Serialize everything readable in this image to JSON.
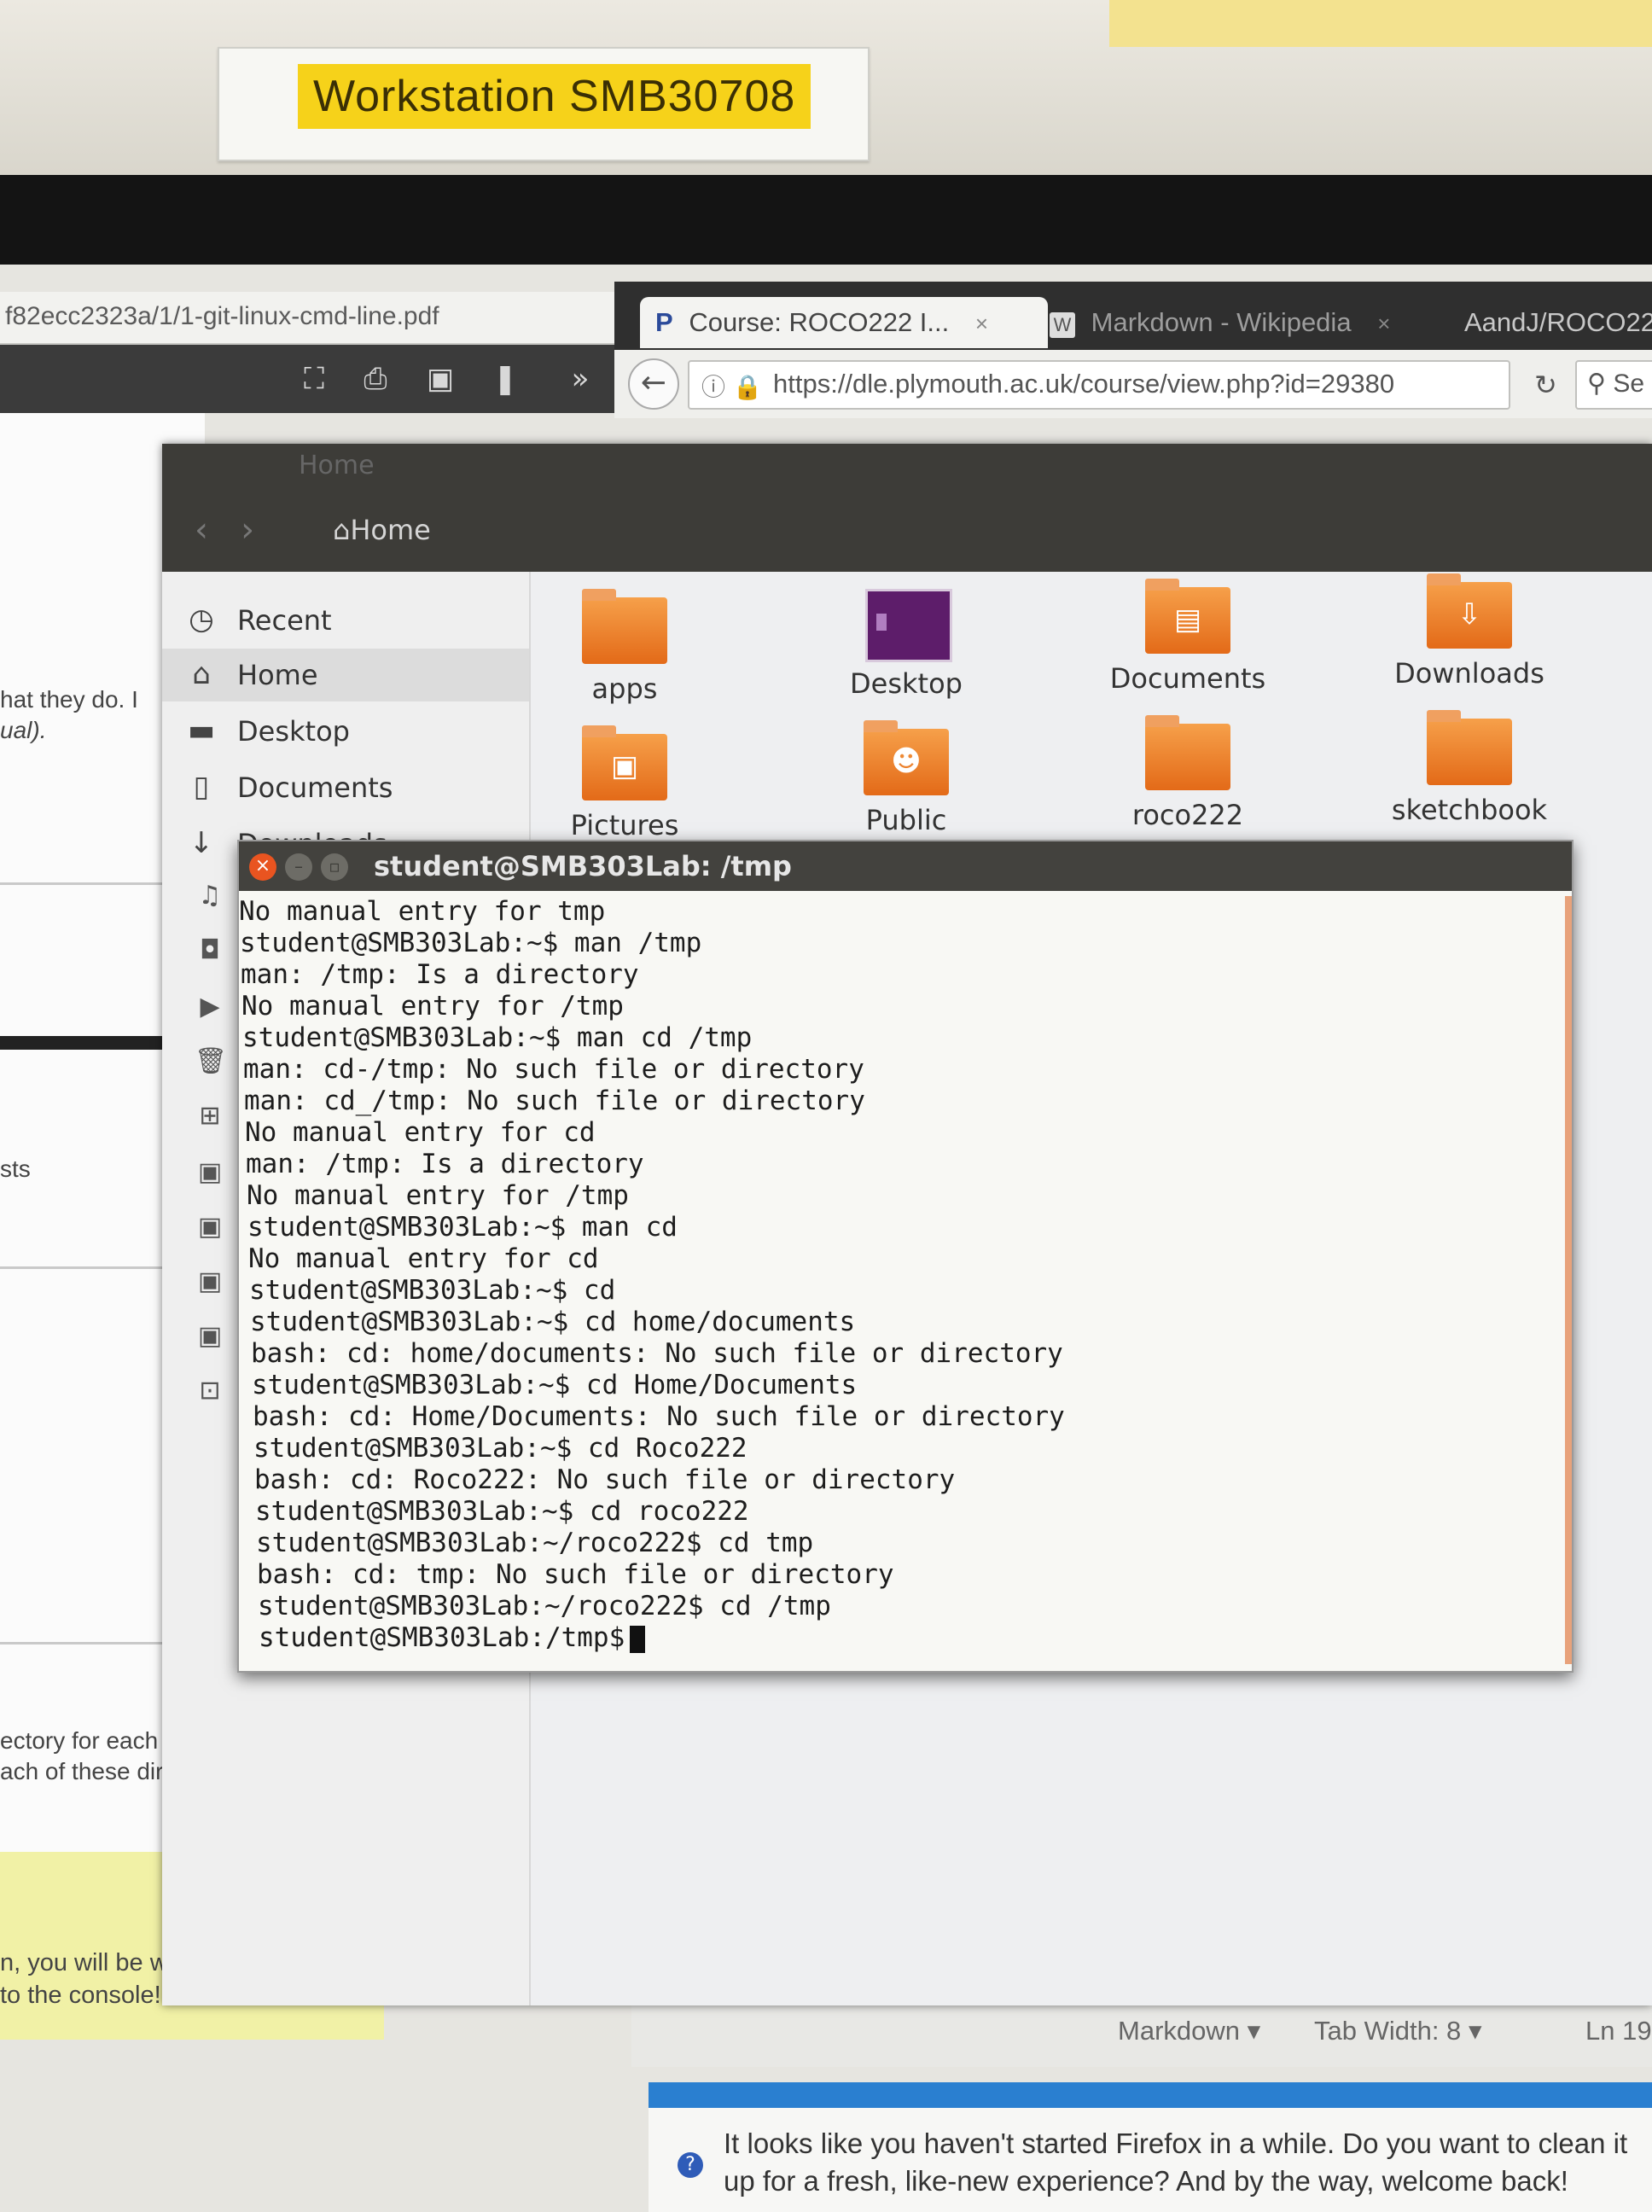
{
  "label": {
    "text": "Workstation  SMB30708"
  },
  "pdf": {
    "url": "f82ecc2323a/1/1-git-linux-cmd-line.pdf",
    "text_1": "hat they do. I",
    "text_2": "ual).",
    "text_3": "sts",
    "text_4": "ectory for each o",
    "text_5": "ach of these direc",
    "note_1": "n, you will be work",
    "note_2": " to the console!"
  },
  "firefox": {
    "tabs": [
      {
        "label": "Course: ROCO222 I...",
        "close": "×",
        "favicon": "P"
      },
      {
        "label": "Markdown - Wikipedia",
        "close": "×",
        "favicon": "W"
      },
      {
        "label": "AandJ/ROCO22"
      }
    ],
    "url": "https://dle.plymouth.ac.uk/course/view.php?id=29380",
    "search_placeholder": "Se",
    "notification": "It looks like you haven't started Firefox in a while. Do you want to clean it up for a fresh, like-new experience? And by the way, welcome back!"
  },
  "editor_status": {
    "language": "Markdown",
    "tab_width": "Tab Width: 8",
    "line": "Ln 19"
  },
  "file_manager": {
    "title": "Home",
    "breadcrumb": "Home",
    "sidebar": [
      {
        "label": "Recent",
        "icon": "clock-icon"
      },
      {
        "label": "Home",
        "icon": "home-icon"
      },
      {
        "label": "Desktop",
        "icon": "folder-icon"
      },
      {
        "label": "Documents",
        "icon": "document-icon"
      },
      {
        "label": "Downloads",
        "icon": "download-icon"
      }
    ],
    "folders": [
      {
        "label": "apps"
      },
      {
        "label": "Desktop"
      },
      {
        "label": "Documents"
      },
      {
        "label": "Downloads"
      },
      {
        "label": "Pictures"
      },
      {
        "label": "Public"
      },
      {
        "label": "roco222"
      },
      {
        "label": "sketchbook"
      }
    ]
  },
  "terminal": {
    "title": "student@SMB303Lab: /tmp",
    "lines": [
      "No manual entry for tmp",
      "student@SMB303Lab:~$ man /tmp",
      "man: /tmp: Is a directory",
      "No manual entry for /tmp",
      "student@SMB303Lab:~$ man cd /tmp",
      "man: cd-/tmp: No such file or directory",
      "man: cd_/tmp: No such file or directory",
      "No manual entry for cd",
      "man: /tmp: Is a directory",
      "No manual entry for /tmp",
      "student@SMB303Lab:~$ man cd",
      "No manual entry for cd",
      "student@SMB303Lab:~$ cd",
      "student@SMB303Lab:~$ cd home/documents",
      "bash: cd: home/documents: No such file or directory",
      "student@SMB303Lab:~$ cd Home/Documents",
      "bash: cd: Home/Documents: No such file or directory",
      "student@SMB303Lab:~$ cd Roco222",
      "bash: cd: Roco222: No such file or directory",
      "student@SMB303Lab:~$ cd roco222",
      "student@SMB303Lab:~/roco222$ cd tmp",
      "bash: cd: tmp: No such file or directory",
      "student@SMB303Lab:~/roco222$ cd /tmp",
      "student@SMB303Lab:/tmp$"
    ]
  },
  "colors": {
    "ubuntu_orange": "#e95420",
    "terminal_bg": "#f8f8f4",
    "label_yellow": "#f6d21a"
  }
}
